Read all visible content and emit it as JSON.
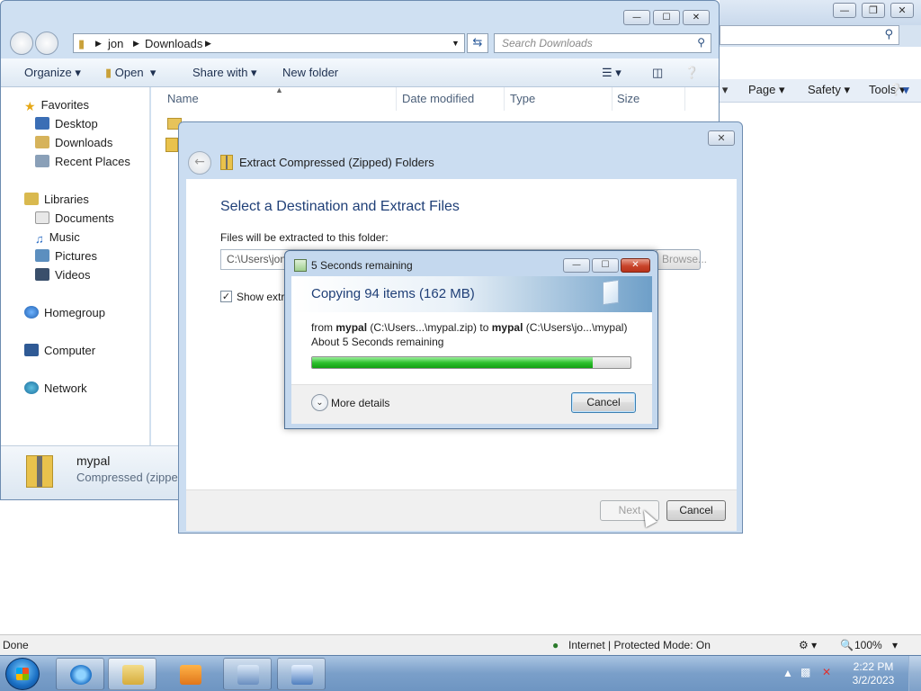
{
  "ie": {
    "commands": [
      "Page",
      "Safety",
      "Tools"
    ],
    "status": {
      "left": "Done",
      "zone": "Internet | Protected Mode: On",
      "zoom": "100%"
    }
  },
  "explorer": {
    "breadcrumb": [
      "jon",
      "Downloads"
    ],
    "search_placeholder": "Search Downloads",
    "toolbar": {
      "organize": "Organize",
      "open": "Open",
      "share_with": "Share with",
      "new_folder": "New folder"
    },
    "nav": {
      "favorites": "Favorites",
      "favorites_items": [
        "Desktop",
        "Downloads",
        "Recent Places"
      ],
      "libraries": "Libraries",
      "libraries_items": [
        "Documents",
        "Music",
        "Pictures",
        "Videos"
      ],
      "homegroup": "Homegroup",
      "computer": "Computer",
      "network": "Network"
    },
    "columns": [
      "Name",
      "Date modified",
      "Type",
      "Size"
    ],
    "details": {
      "name": "mypal",
      "type": "Compressed (zipped)"
    }
  },
  "wizard": {
    "title": "Extract Compressed (Zipped) Folders",
    "heading": "Select a Destination and Extract Files",
    "folder_label": "Files will be extracted to this folder:",
    "folder_value": "C:\\Users\\jon",
    "browse_label": "Browse...",
    "show_files_label": "Show extracted files when complete",
    "next_label": "Next",
    "cancel_label": "Cancel"
  },
  "copy": {
    "title": "5 Seconds remaining",
    "banner": "Copying 94 items (162 MB)",
    "from_prefix": "from ",
    "from_name": "mypal",
    "from_path": " (C:\\Users...\\mypal.zip) to ",
    "to_name": "mypal",
    "to_path": " (C:\\Users\\jo...\\mypal)",
    "remaining": "About 5 Seconds remaining",
    "progress_percent": 88,
    "more_details": "More details",
    "cancel_label": "Cancel"
  },
  "taskbar": {
    "time": "2:22 PM",
    "date": "3/2/2023"
  },
  "colors": {
    "accent": "#1f3f77",
    "progress": "#2ec12e",
    "close_red": "#c8442a"
  }
}
